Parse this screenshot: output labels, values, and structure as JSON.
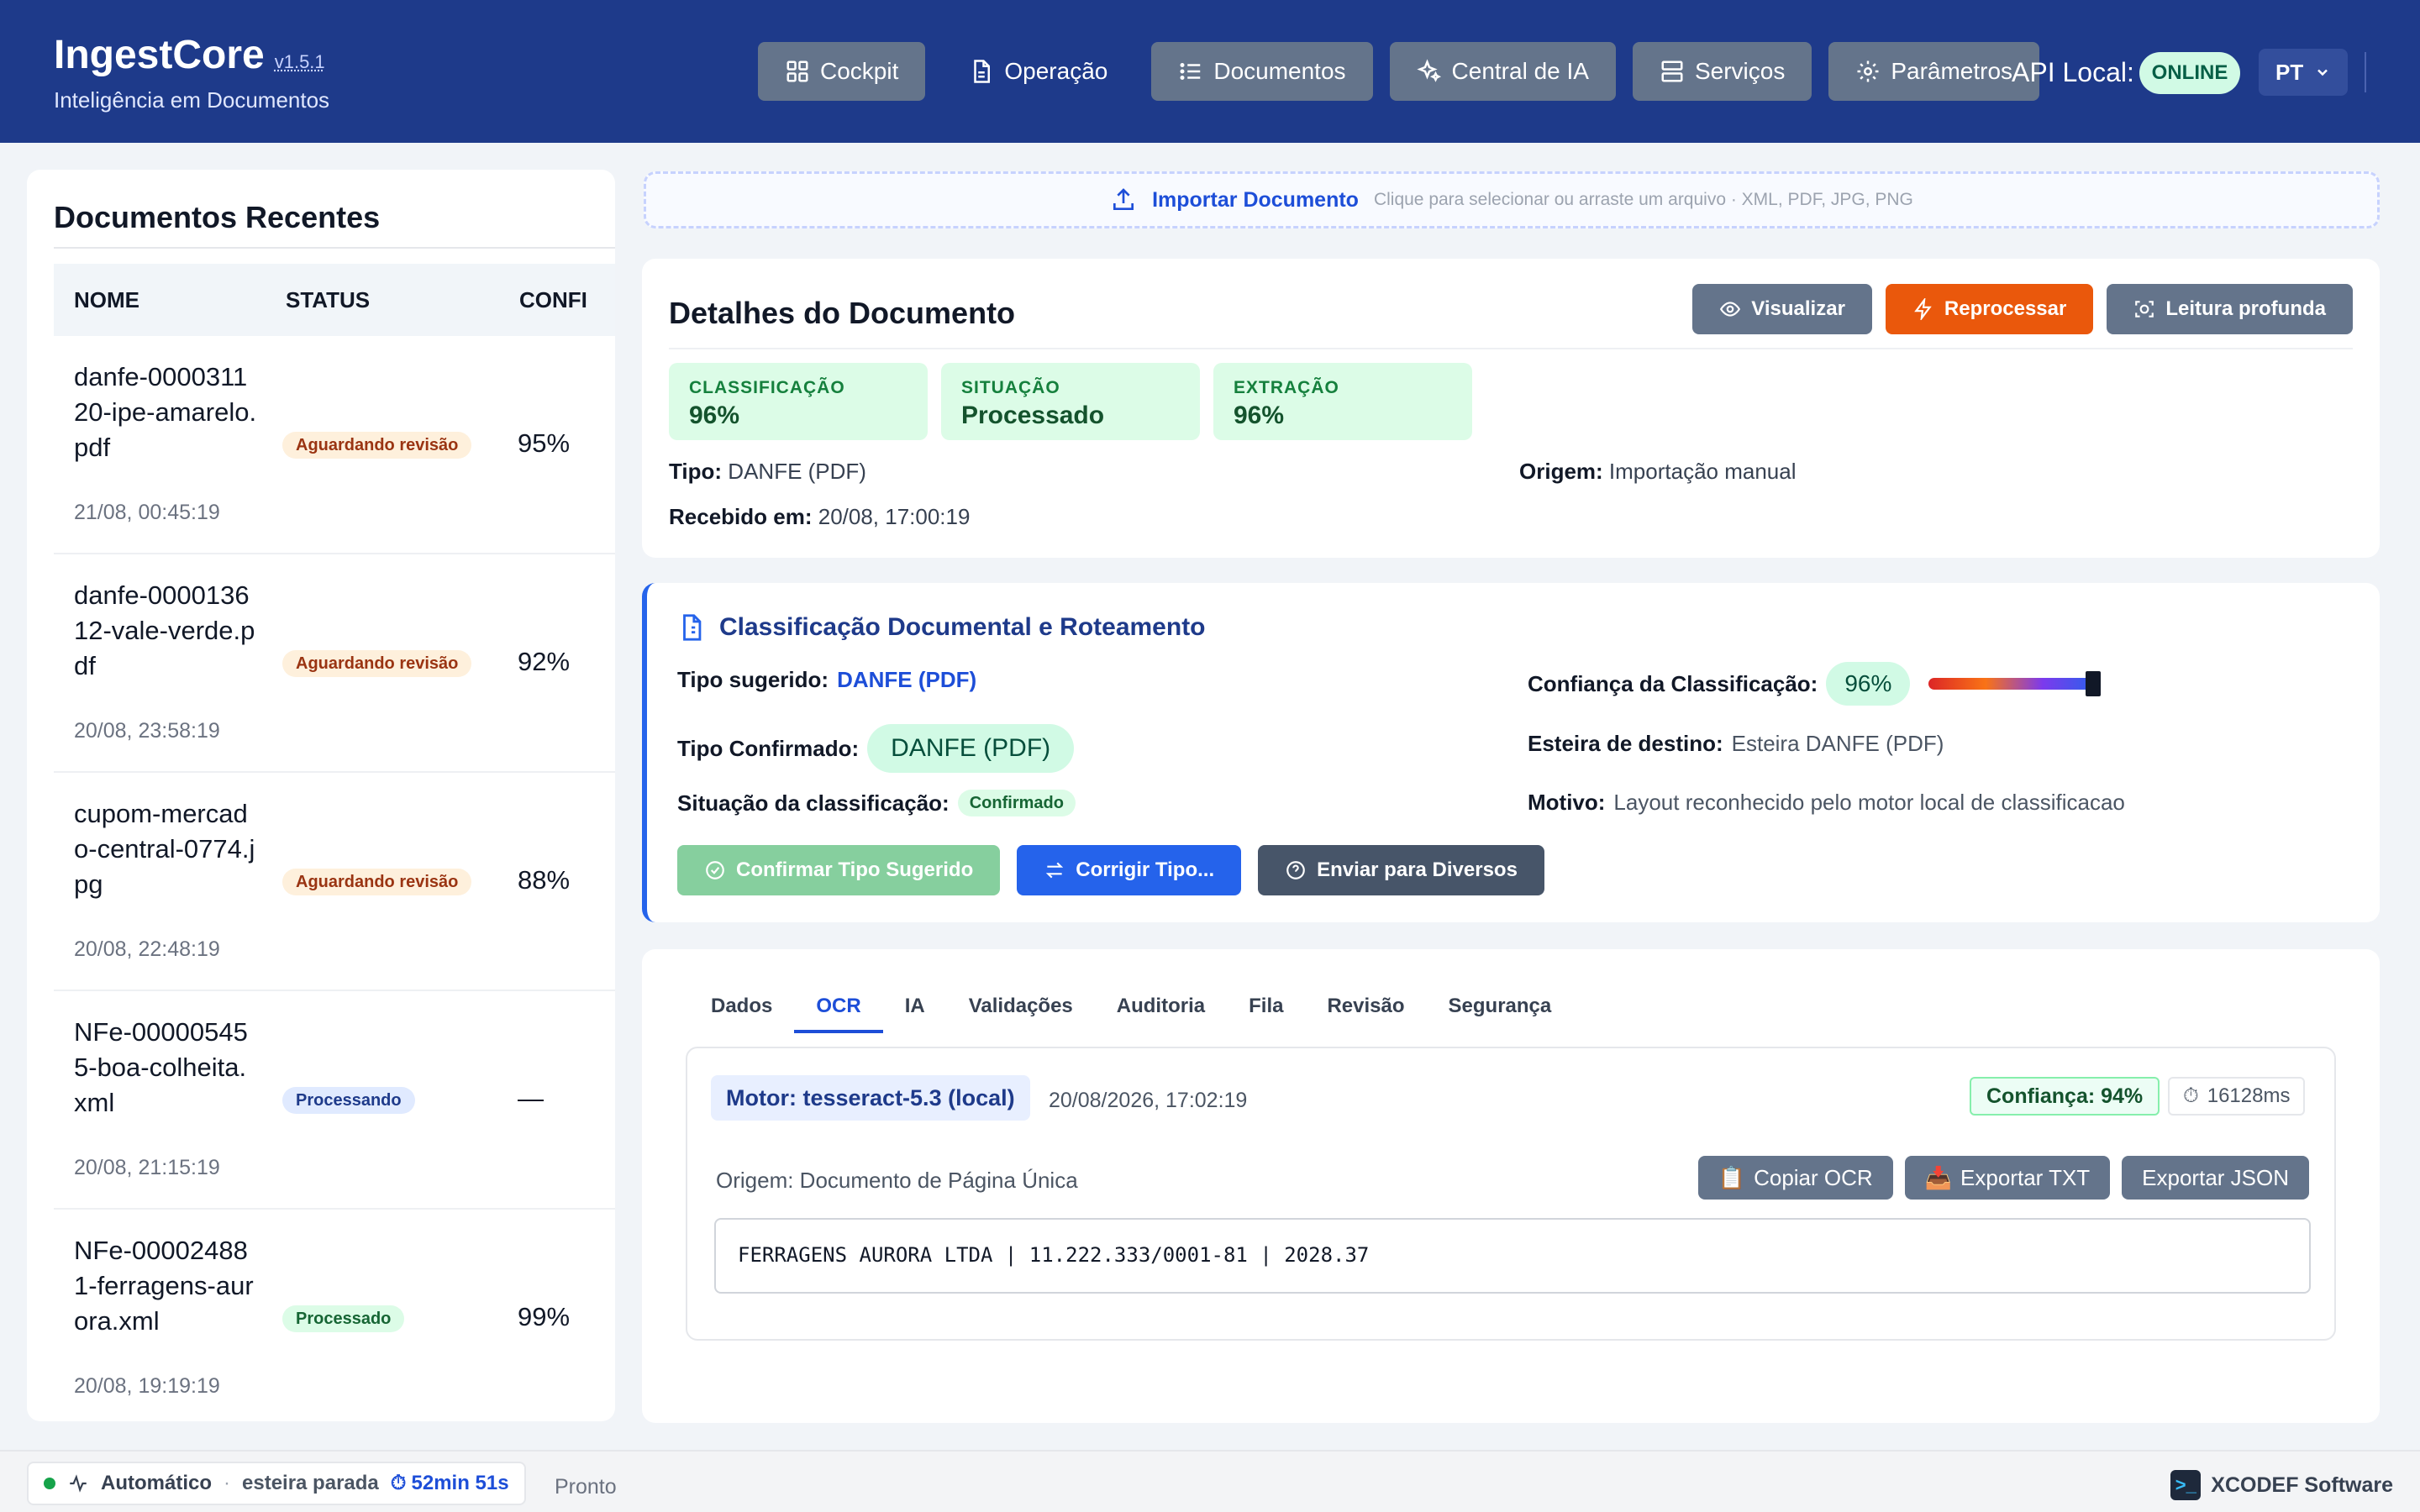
{
  "header": {
    "app_name": "IngestCore",
    "version": "v1.5.1",
    "subtitle": "Inteligência em Documentos",
    "nav": [
      {
        "label": "Cockpit",
        "icon": "grid-icon"
      },
      {
        "label": "Operação",
        "icon": "file-icon"
      },
      {
        "label": "Documentos",
        "icon": "list-icon"
      },
      {
        "label": "Central de IA",
        "icon": "sparkles-icon"
      },
      {
        "label": "Serviços",
        "icon": "server-icon"
      },
      {
        "label": "Parâmetros",
        "icon": "gear-icon"
      }
    ],
    "api_label": "API Local:",
    "api_status": "ONLINE",
    "language": "PT"
  },
  "recent": {
    "title": "Documentos Recentes",
    "columns": [
      "NOME",
      "STATUS",
      "CONFI"
    ],
    "items": [
      {
        "name": "danfe-000031120-ipe-amarelo.pdf",
        "date": "21/08, 00:45:19",
        "status": "Aguardando revisão",
        "status_kind": "aguardando",
        "confidence": "95%"
      },
      {
        "name": "danfe-000013612-vale-verde.pdf",
        "date": "20/08, 23:58:19",
        "status": "Aguardando revisão",
        "status_kind": "aguardando",
        "confidence": "92%"
      },
      {
        "name": "cupom-mercado-central-0774.jpg",
        "date": "20/08, 22:48:19",
        "status": "Aguardando revisão",
        "status_kind": "aguardando",
        "confidence": "88%"
      },
      {
        "name": "NFe-000005455-boa-colheita.xml",
        "date": "20/08, 21:15:19",
        "status": "Processando",
        "status_kind": "processando",
        "confidence": "—"
      },
      {
        "name": "NFe-000024881-ferragens-aurora.xml",
        "date": "20/08, 19:19:19",
        "status": "Processado",
        "status_kind": "processado",
        "confidence": "99%"
      }
    ]
  },
  "import": {
    "label": "Importar Documento",
    "hint": "Clique para selecionar ou arraste um arquivo · XML, PDF, JPG, PNG"
  },
  "details": {
    "title": "Detalhes do Documento",
    "actions": {
      "view": "Visualizar",
      "reprocess": "Reprocessar",
      "deep_read": "Leitura profunda"
    },
    "stats": [
      {
        "label": "CLASSIFICAÇÃO",
        "value": "96%"
      },
      {
        "label": "SITUAÇÃO",
        "value": "Processado"
      },
      {
        "label": "EXTRAÇÃO",
        "value": "96%"
      }
    ],
    "tipo_label": "Tipo:",
    "tipo_value": "DANFE (PDF)",
    "origem_label": "Origem:",
    "origem_value": "Importação manual",
    "recebido_label": "Recebido em:",
    "recebido_value": "20/08, 17:00:19"
  },
  "classification": {
    "title": "Classificação Documental e Roteamento",
    "suggested_label": "Tipo sugerido:",
    "suggested_value": "DANFE (PDF)",
    "confirmed_label": "Tipo Confirmado:",
    "confirmed_value": "DANFE (PDF)",
    "situation_label": "Situação da classificação:",
    "situation_value": "Confirmado",
    "confidence_label": "Confiança da Classificação:",
    "confidence_value": "96%",
    "confidence_level": 0.96,
    "destination_label": "Esteira de destino:",
    "destination_value": "Esteira DANFE (PDF)",
    "reason_label": "Motivo:",
    "reason_value": "Layout reconhecido pelo motor local de classificacao",
    "actions": {
      "confirm": "Confirmar Tipo Sugerido",
      "correct": "Corrigir Tipo...",
      "send": "Enviar para Diversos"
    }
  },
  "tabs": {
    "items": [
      "Dados",
      "OCR",
      "IA",
      "Validações",
      "Auditoria",
      "Fila",
      "Revisão",
      "Segurança"
    ],
    "active": "OCR"
  },
  "ocr": {
    "engine": "Motor: tesseract-5.3 (local)",
    "timestamp": "20/08/2026, 17:02:19",
    "confidence": "Confiança: 94%",
    "duration": "16128ms",
    "origin": "Origem: Documento de Página Única",
    "actions": {
      "copy": "Copiar OCR",
      "export_txt": "Exportar TXT",
      "export_json": "Exportar JSON"
    },
    "text": "FERRAGENS AURORA LTDA | 11.222.333/0001-81 | 2028.37"
  },
  "footer": {
    "mode": "Automático",
    "separator": "·",
    "belt_status": "esteira parada",
    "timer": "52min 51s",
    "state": "Pronto",
    "brand": "XCODEF Software"
  },
  "colors": {
    "header_bg": "#1e3a8a",
    "accent_blue": "#2563eb",
    "reprocess_orange": "#ea580c",
    "success_green": "#16a34a"
  }
}
